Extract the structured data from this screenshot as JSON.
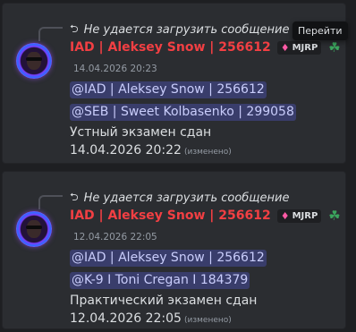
{
  "messages": [
    {
      "reply_text": "Не удается загрузить сообщение",
      "author": "IAD | Aleksey Snow | 256612",
      "tag": "MJRP",
      "timestamp": "14.04.2026 20:23",
      "mentions": [
        "@IAD | Aleksey Snow | 256612",
        "@SEB | Sweet Kolbasenko | 299058"
      ],
      "text": "Устный экзамен сдан",
      "date": "14.04.2026 20:22",
      "edited": "(изменено)"
    },
    {
      "reply_text": "Не удается загрузить сообщение",
      "author": "IAD | Aleksey Snow | 256612",
      "tag": "MJRP",
      "timestamp": "12.04.2026 22:05",
      "mentions": [
        "@IAD | Aleksey Snow | 256612",
        "@K-9 I Toni Cregan I 184379"
      ],
      "text": "Практический экзамен сдан",
      "date": "12.04.2026 22:05",
      "edited": "(изменено)"
    }
  ],
  "tooltip": {
    "goto_label": "Перейти"
  },
  "colors": {
    "author": "#f23f43",
    "mention_bg": "#5865f24d",
    "background": "#1e1f22",
    "card": "#2b2d31"
  },
  "icons": {
    "reply": "reply-arrow-icon",
    "tag": "gem-icon",
    "badge": "clover-icon"
  }
}
